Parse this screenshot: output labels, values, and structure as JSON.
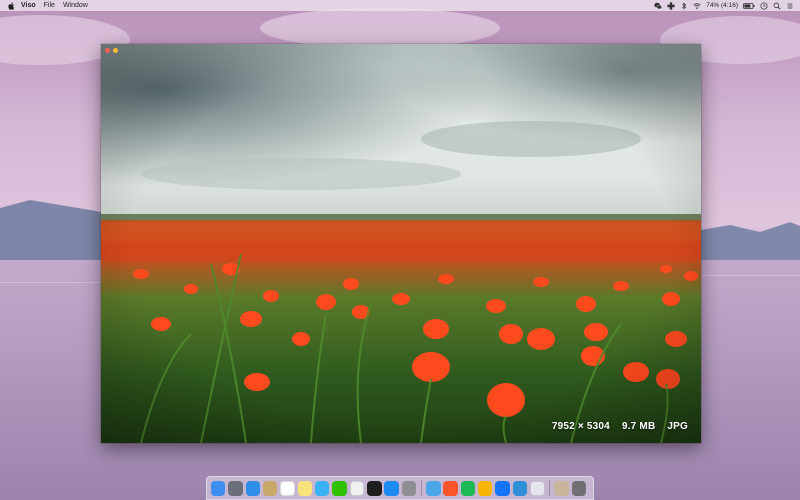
{
  "menubar": {
    "app_name": "Viso",
    "menus": [
      "File",
      "Window"
    ],
    "battery": "74% (4:16)",
    "status_icons": [
      "wechat-icon",
      "plus-cross-icon",
      "bluetooth-icon",
      "wifi-icon",
      "battery-icon",
      "clock-icon",
      "search-icon",
      "notification-center-icon"
    ]
  },
  "window": {
    "buttons": [
      "close",
      "minimize"
    ],
    "image_info": {
      "dimensions": "7952 × 5304",
      "size": "9.7 MB",
      "format": "JPG"
    }
  },
  "dock": {
    "apps": [
      {
        "name": "finder-icon",
        "color": "#3d8ef0"
      },
      {
        "name": "launchpad-icon",
        "color": "#6a6f7a"
      },
      {
        "name": "safari-icon",
        "color": "#2f8ee8"
      },
      {
        "name": "notes-app-icon",
        "color": "#c9a86a"
      },
      {
        "name": "calendar-icon",
        "color": "#ffffff"
      },
      {
        "name": "stickies-icon",
        "color": "#f7e27c"
      },
      {
        "name": "messages-icon",
        "color": "#39b3f5"
      },
      {
        "name": "wechat-icon",
        "color": "#2dc100"
      },
      {
        "name": "itunes-icon",
        "color": "#f0f0f0"
      },
      {
        "name": "terminal-icon",
        "color": "#1e1e1e"
      },
      {
        "name": "app-store-icon",
        "color": "#1c8cf2"
      },
      {
        "name": "system-preferences-icon",
        "color": "#8e8e93"
      },
      {
        "name": "chrome-icon",
        "color": "#4ba7ea"
      },
      {
        "name": "brave-icon",
        "color": "#fb542b"
      },
      {
        "name": "spotify-icon",
        "color": "#1db954"
      },
      {
        "name": "sketch-icon",
        "color": "#f7b500"
      },
      {
        "name": "xcode-icon",
        "color": "#1575f9"
      },
      {
        "name": "vscode-icon",
        "color": "#2f8fd8"
      },
      {
        "name": "viso-app-icon",
        "color": "#e6e6ee"
      },
      {
        "name": "preview-icon",
        "color": "#c8b59a"
      },
      {
        "name": "trash-icon",
        "color": "#6f6f74"
      }
    ]
  }
}
